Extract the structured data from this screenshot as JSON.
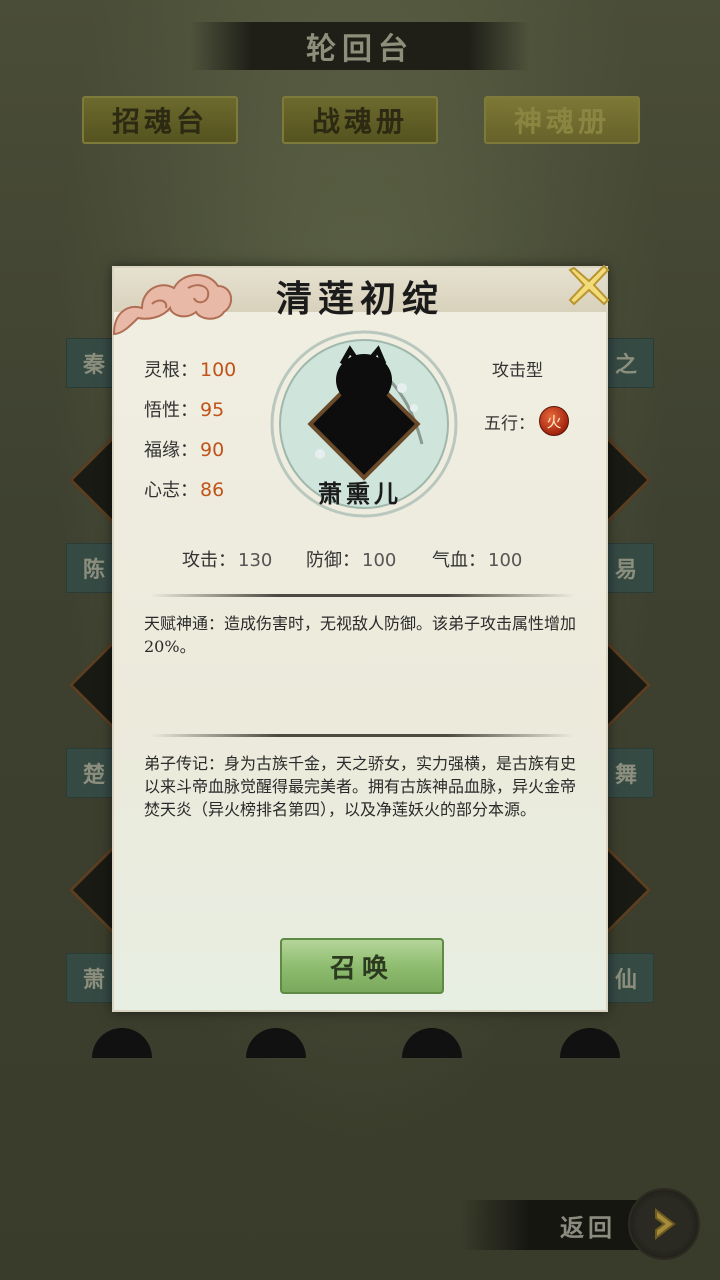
{
  "header": {
    "title": "轮回台"
  },
  "tabs": [
    {
      "label": "招魂台",
      "active": false
    },
    {
      "label": "战魂册",
      "active": false
    },
    {
      "label": "神魂册",
      "active": true
    }
  ],
  "background_labels": {
    "left": [
      "秦",
      "陈",
      "楚",
      "萧"
    ],
    "right": [
      "之",
      "易",
      "舞",
      "仙"
    ]
  },
  "dialog": {
    "title": "清莲初绽",
    "stats": [
      {
        "label": "灵根：",
        "value": "100"
      },
      {
        "label": "悟性：",
        "value": "95"
      },
      {
        "label": "福缘：",
        "value": "90"
      },
      {
        "label": "心志：",
        "value": "86"
      }
    ],
    "type": "攻击型",
    "element_label": "五行：",
    "element_icon": "fire-icon",
    "element_glyph": "火",
    "character_name": "萧熏儿",
    "combat": [
      {
        "label": "攻击：",
        "value": "130"
      },
      {
        "label": "防御：",
        "value": "100"
      },
      {
        "label": "气血：",
        "value": "100"
      }
    ],
    "talent": "天赋神通：造成伤害时，无视敌人防御。该弟子攻击属性增加20%。",
    "biography": "弟子传记：身为古族千金，天之骄女，实力强横，是古族有史以来斗帝血脉觉醒得最完美者。拥有古族神品血脉，异火金帝焚天炎（异火榜排名第四），以及净莲妖火的部分本源。",
    "summon_label": "召唤"
  },
  "footer": {
    "back_label": "返回"
  },
  "colors": {
    "stat_value": "#c0541a",
    "summon_green": "#8fbd70",
    "tab_olive": "#5f5c25"
  }
}
